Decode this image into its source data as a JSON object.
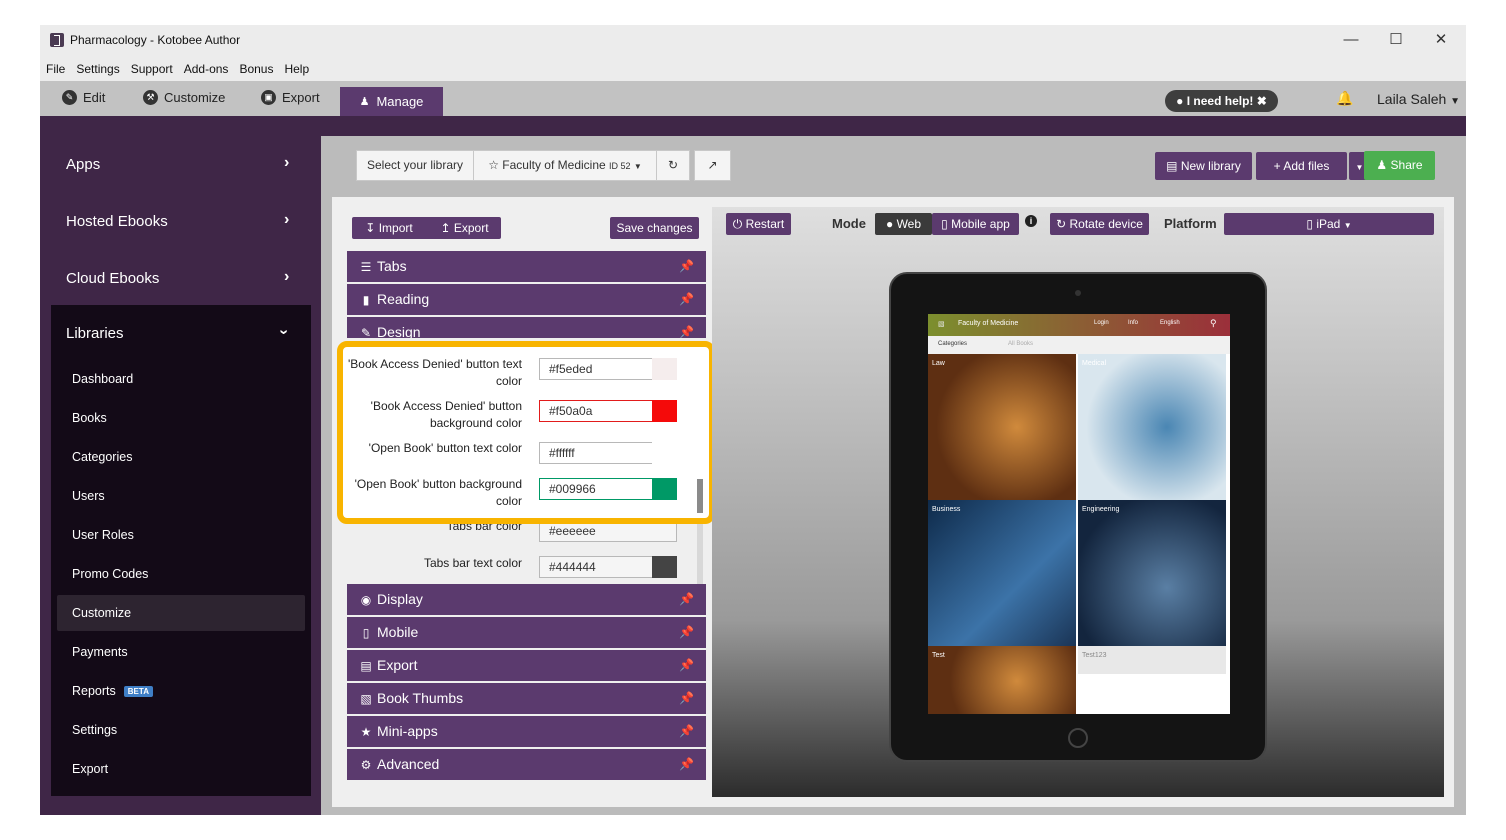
{
  "window": {
    "title": "Pharmacology - Kotobee Author",
    "controls": {
      "minimize": "—",
      "maximize": "☐",
      "close": "✕"
    }
  },
  "menu": [
    "File",
    "Settings",
    "Support",
    "Add-ons",
    "Bonus",
    "Help"
  ],
  "top_tabs": {
    "edit": "Edit",
    "customize": "Customize",
    "export": "Export",
    "manage": "Manage"
  },
  "header": {
    "help": "I need help!",
    "user": "Laila Saleh"
  },
  "sidebar": {
    "main_items": [
      {
        "label": "Apps"
      },
      {
        "label": "Hosted Ebooks"
      },
      {
        "label": "Cloud Ebooks"
      },
      {
        "label": "Libraries"
      }
    ],
    "library_items": [
      "Dashboard",
      "Books",
      "Categories",
      "Users",
      "User Roles",
      "Promo Codes",
      "Customize",
      "Payments",
      "Reports",
      "Settings",
      "Export"
    ],
    "beta_badge": "BETA",
    "selected": "Customize"
  },
  "library_bar": {
    "select_label": "Select your library",
    "library_name": "Faculty of Medicine",
    "library_id": "ID 52",
    "new_library": "New library",
    "add_files": "Add files",
    "share": "Share"
  },
  "editor": {
    "import": "Import",
    "export": "Export",
    "save": "Save changes",
    "sections_top": [
      "Tabs",
      "Reading",
      "Design"
    ],
    "sections_bottom": [
      "Display",
      "Mobile",
      "Export",
      "Book Thumbs",
      "Mini-apps",
      "Advanced"
    ],
    "fields": [
      {
        "label": "'Book Access Denied' button text color",
        "value": "#f5eded",
        "swatch": "#f5eded"
      },
      {
        "label": "'Book Access Denied' button background color",
        "value": "#f50a0a",
        "swatch": "#f50a0a"
      },
      {
        "label": "'Open Book' button text color",
        "value": "#ffffff",
        "swatch": "#ffffff"
      },
      {
        "label": "'Open Book' button background color",
        "value": "#009966",
        "swatch": "#009966"
      },
      {
        "label": "Tabs bar color",
        "value": "#eeeeee",
        "swatch": "#eeeeee"
      },
      {
        "label": "Tabs bar text color",
        "value": "#444444",
        "swatch": "#444444"
      }
    ]
  },
  "preview_toolbar": {
    "restart": "Restart",
    "mode_label": "Mode",
    "web": "Web",
    "mobile_app": "Mobile app",
    "rotate": "Rotate device",
    "platform_label": "Platform",
    "platform": "iPad"
  },
  "device_screen": {
    "library_title": "Faculty of Medicine",
    "nav": [
      "Login",
      "Info",
      "English"
    ],
    "tabs": [
      "Categories",
      "All Books"
    ],
    "categories": [
      "Law",
      "Medical",
      "Business",
      "Engineering",
      "Test",
      "Test123"
    ]
  },
  "colors": {
    "brand_purple": "#5b3a6e",
    "sidebar_dark": "#3f2647",
    "highlight": "#f8b400",
    "share_green": "#4caf50"
  }
}
